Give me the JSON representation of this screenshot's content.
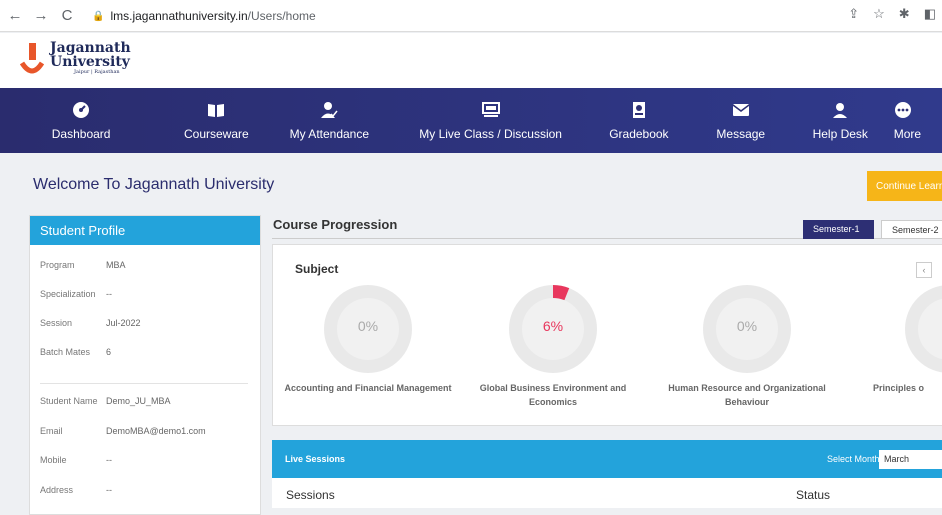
{
  "browser": {
    "url_host": "lms.jagannathuniversity.in",
    "url_path": "/Users/home"
  },
  "logo": {
    "line1": "Jagannath",
    "line2": "University",
    "line3": "Jaipur | Rajasthan"
  },
  "menu": [
    {
      "label": "Dashboard",
      "icon": "gauge-icon"
    },
    {
      "label": "Courseware",
      "icon": "book-icon"
    },
    {
      "label": "My Attendance",
      "icon": "person-check-icon"
    },
    {
      "label": "My Live Class / Discussion",
      "icon": "presentation-icon"
    },
    {
      "label": "Gradebook",
      "icon": "gradebook-icon"
    },
    {
      "label": "Message",
      "icon": "envelope-icon"
    },
    {
      "label": "Help Desk",
      "icon": "support-icon"
    },
    {
      "label": "More",
      "icon": "more-icon"
    }
  ],
  "welcome": "Welcome To Jagannath University",
  "continue_label": "Continue Learning",
  "profile": {
    "title": "Student Profile",
    "rows": [
      {
        "k": "Program",
        "v": "MBA"
      },
      {
        "k": "Specialization",
        "v": "--"
      },
      {
        "k": "Session",
        "v": "Jul-2022"
      },
      {
        "k": "Batch Mates",
        "v": "6"
      },
      {
        "k": "Student Name",
        "v": "Demo_JU_MBA"
      },
      {
        "k": "Email",
        "v": "DemoMBA@demo1.com"
      },
      {
        "k": "Mobile",
        "v": "--"
      },
      {
        "k": "Address",
        "v": "--"
      }
    ]
  },
  "course_progression": {
    "title": "Course Progression",
    "semesters": [
      "Semester-1",
      "Semester-2"
    ],
    "subject_label": "Subject",
    "prev_arrow": "‹",
    "courses": [
      {
        "name": "Accounting and Financial Management",
        "pct_label": "0%",
        "pct": 0
      },
      {
        "name": "Global Business Environment and Economics",
        "pct_label": "6%",
        "pct": 6
      },
      {
        "name": "Human Resource and Organizational Behaviour",
        "pct_label": "0%",
        "pct": 0
      },
      {
        "name": "Principles o",
        "pct_label": "",
        "pct": 0
      }
    ]
  },
  "live_sessions": {
    "title": "Live Sessions",
    "select_label": "Select Month",
    "select_value": "March",
    "col_sessions": "Sessions",
    "col_status": "Status"
  },
  "colors": {
    "menu_bg": "#2d2f74",
    "accent_blue": "#23a3db",
    "progress": "#e8375d",
    "continue": "#f6b518"
  }
}
